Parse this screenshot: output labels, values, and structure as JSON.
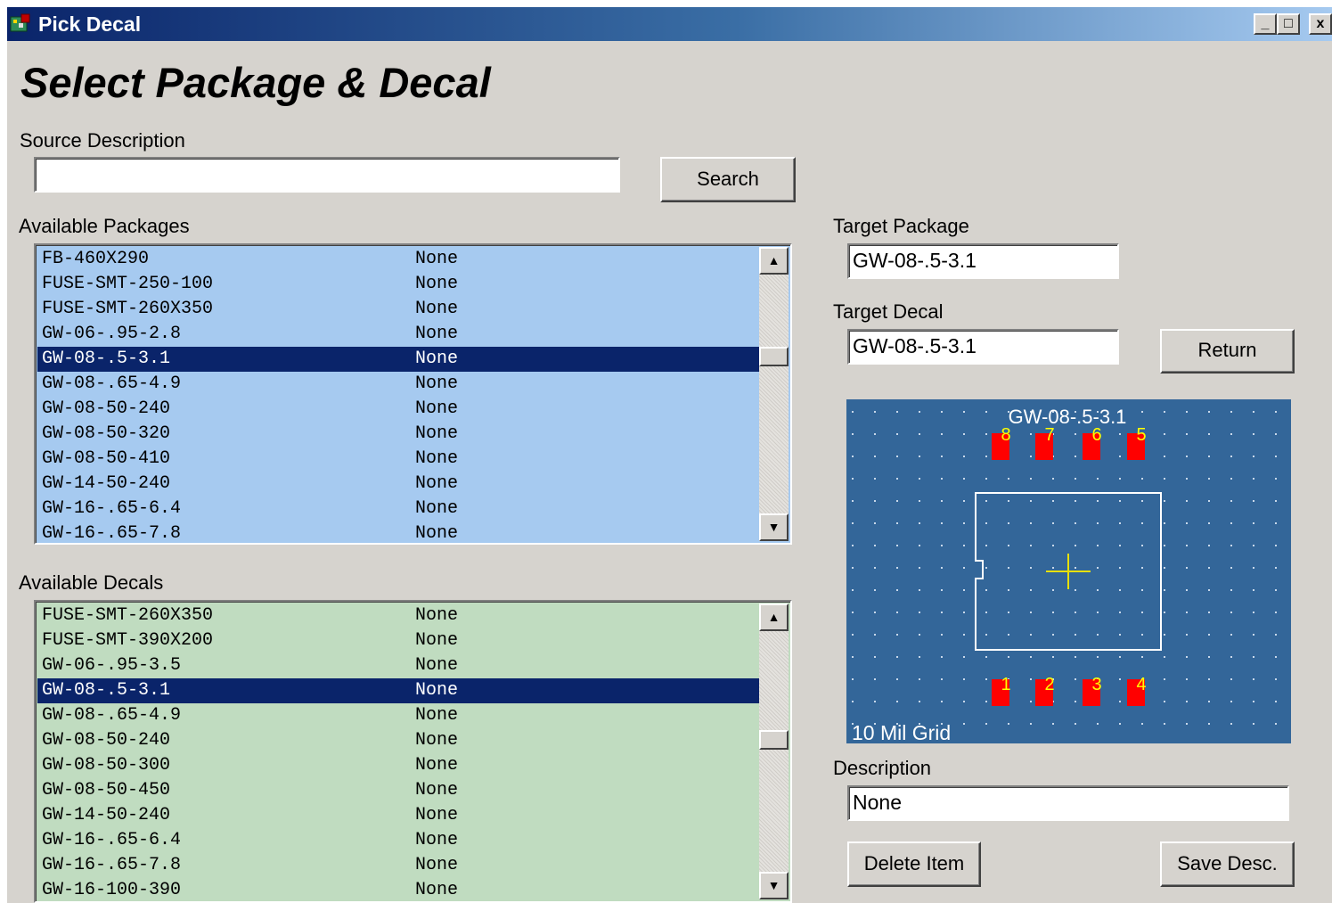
{
  "window": {
    "title": "Pick Decal",
    "minimize": "_",
    "maximize": "□",
    "close": "x"
  },
  "heading": "Select Package & Decal",
  "source": {
    "label": "Source Description",
    "value": "",
    "search_label": "Search"
  },
  "packages": {
    "label": "Available Packages",
    "bg_color": "#a6caf0",
    "items": [
      {
        "name": "FB-460X290",
        "desc": "None"
      },
      {
        "name": "FUSE-SMT-250-100",
        "desc": "None"
      },
      {
        "name": "FUSE-SMT-260X350",
        "desc": "None"
      },
      {
        "name": "GW-06-.95-2.8",
        "desc": "None"
      },
      {
        "name": "GW-08-.5-3.1",
        "desc": "None",
        "selected": true
      },
      {
        "name": "GW-08-.65-4.9",
        "desc": "None"
      },
      {
        "name": "GW-08-50-240",
        "desc": "None"
      },
      {
        "name": "GW-08-50-320",
        "desc": "None"
      },
      {
        "name": "GW-08-50-410",
        "desc": "None"
      },
      {
        "name": "GW-14-50-240",
        "desc": "None"
      },
      {
        "name": "GW-16-.65-6.4",
        "desc": "None"
      },
      {
        "name": "GW-16-.65-7.8",
        "desc": "None"
      }
    ]
  },
  "decals": {
    "label": "Available Decals",
    "bg_color": "#c0dcc0",
    "items": [
      {
        "name": "FUSE-SMT-260X350",
        "desc": "None"
      },
      {
        "name": "FUSE-SMT-390X200",
        "desc": "None"
      },
      {
        "name": "GW-06-.95-3.5",
        "desc": "None"
      },
      {
        "name": "GW-08-.5-3.1",
        "desc": "None",
        "selected": true
      },
      {
        "name": "GW-08-.65-4.9",
        "desc": "None"
      },
      {
        "name": "GW-08-50-240",
        "desc": "None"
      },
      {
        "name": "GW-08-50-300",
        "desc": "None"
      },
      {
        "name": "GW-08-50-450",
        "desc": "None"
      },
      {
        "name": "GW-14-50-240",
        "desc": "None"
      },
      {
        "name": "GW-16-.65-6.4",
        "desc": "None"
      },
      {
        "name": "GW-16-.65-7.8",
        "desc": "None"
      },
      {
        "name": "GW-16-100-390",
        "desc": "None"
      }
    ]
  },
  "target_package": {
    "label": "Target Package",
    "value": "GW-08-.5-3.1"
  },
  "target_decal": {
    "label": "Target Decal",
    "value": "GW-08-.5-3.1"
  },
  "return_label": "Return",
  "preview": {
    "name": "GW-08-.5-3.1",
    "grid_label": "10 Mil Grid",
    "top_pins": [
      "8",
      "7",
      "6",
      "5"
    ],
    "bottom_pins": [
      "1",
      "2",
      "3",
      "4"
    ],
    "bg_color": "#336699",
    "pad_color": "#ff0000",
    "pin_label_color": "#ffff00"
  },
  "description": {
    "label": "Description",
    "value": "None"
  },
  "delete_label": "Delete Item",
  "save_label": "Save Desc."
}
